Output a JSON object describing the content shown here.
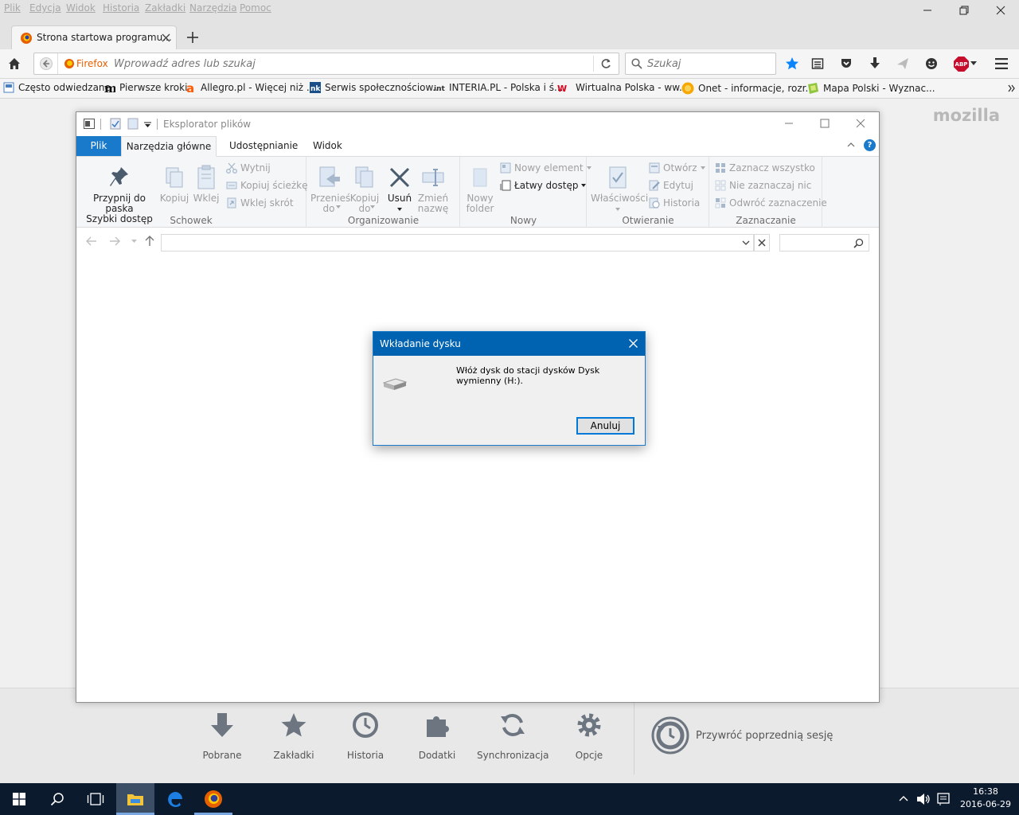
{
  "firefox": {
    "menu": [
      "Plik",
      "Edycja",
      "Widok",
      "Historia",
      "Zakładki",
      "Narzędzia",
      "Pomoc"
    ],
    "tab_title": "Strona startowa programu...",
    "url_identity": "Firefox",
    "url_placeholder": "Wprowadź adres lub szukaj",
    "search_placeholder": "Szukaj",
    "abp_badge": "ABP",
    "bookmarks": [
      {
        "label": "Często odwiedzane",
        "icon": "frequent-icon"
      },
      {
        "label": "Pierwsze kroki",
        "icon": "mozilla-m-icon"
      },
      {
        "label": "Allegro.pl - Więcej niż ...",
        "icon": "allegro-icon"
      },
      {
        "label": "Serwis społecznościow...",
        "icon": "nk-icon"
      },
      {
        "label": "INTERIA.PL - Polska i ś...",
        "icon": "interia-icon"
      },
      {
        "label": "Wirtualna Polska - ww...",
        "icon": "wp-icon"
      },
      {
        "label": "Onet - informacje, rozr...",
        "icon": "onet-icon"
      },
      {
        "label": "Mapa Polski - Wyznac...",
        "icon": "map-icon"
      }
    ],
    "logo": "mozilla",
    "launcher": [
      "Pobrane",
      "Zakładki",
      "Historia",
      "Dodatki",
      "Synchronizacja",
      "Opcje"
    ],
    "restore_session": "Przywróć poprzednią sesję"
  },
  "explorer": {
    "title": "Eksplorator plików",
    "tabs": [
      "Plik",
      "Narzędzia główne",
      "Udostępnianie",
      "Widok"
    ],
    "ribbon": {
      "pin_line1": "Przypnij do paska",
      "pin_line2": "Szybki dostęp",
      "copy": "Kopiuj",
      "paste": "Wklej",
      "cut": "Wytnij",
      "copy_path": "Kopiuj ścieżkę",
      "paste_shortcut": "Wklej skrót",
      "group_clipboard": "Schowek",
      "move_line1": "Przenieś",
      "move_line2": "do",
      "copyto_line1": "Kopiuj",
      "copyto_line2": "do",
      "delete": "Usuń",
      "rename_line1": "Zmień",
      "rename_line2": "nazwę",
      "group_organize": "Organizowanie",
      "newfolder_line1": "Nowy",
      "newfolder_line2": "folder",
      "new_item": "Nowy element",
      "easy_access": "Łatwy dostęp",
      "group_new": "Nowy",
      "properties": "Właściwości",
      "open": "Otwórz",
      "edit": "Edytuj",
      "history": "Historia",
      "group_open": "Otwieranie",
      "select_all": "Zaznacz wszystko",
      "select_none": "Nie zaznaczaj nic",
      "invert": "Odwróć zaznaczenie",
      "group_select": "Zaznaczanie"
    }
  },
  "dialog": {
    "title": "Wkładanie dysku",
    "message": "Włóż dysk do stacji dysków Dysk wymienny (H:).",
    "cancel": "Anuluj"
  },
  "taskbar": {
    "time": "16:38",
    "date": "2016-06-29"
  },
  "colors": {
    "accent": "#0063b1",
    "file_tab": "#1979ca",
    "taskbar": "#0c1a2e",
    "firefox_star": "#0a84ff"
  }
}
